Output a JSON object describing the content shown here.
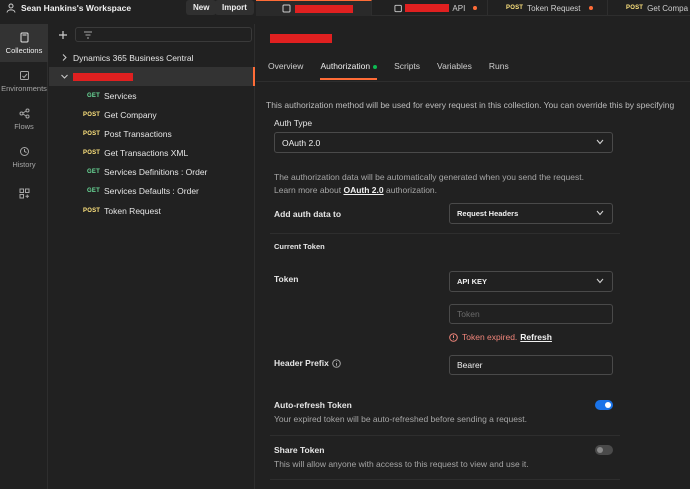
{
  "workspace": {
    "title": "Sean Hankins's Workspace",
    "new_label": "New",
    "import_label": "Import"
  },
  "rail": [
    {
      "label": "Collections",
      "icon": "collections-icon"
    },
    {
      "label": "Environments",
      "icon": "environments-icon"
    },
    {
      "label": "Flows",
      "icon": "flows-icon"
    },
    {
      "label": "History",
      "icon": "history-icon"
    },
    {
      "label": "",
      "icon": "configure-workbench-icon"
    }
  ],
  "sidebar": {
    "collections": [
      {
        "name": "Dynamics 365 Business Central",
        "expanded": false
      },
      {
        "name": "",
        "expanded": true,
        "redacted": true
      }
    ],
    "requests": [
      {
        "method": "GET",
        "name": "Services"
      },
      {
        "method": "POST",
        "name": "Get Company"
      },
      {
        "method": "POST",
        "name": "Post Transactions"
      },
      {
        "method": "POST",
        "name": "Get Transactions XML"
      },
      {
        "method": "GET",
        "name": "Services Definitions : Order"
      },
      {
        "method": "GET",
        "name": "Services Defaults : Order"
      },
      {
        "method": "POST",
        "name": "Token Request"
      }
    ]
  },
  "tabs": [
    {
      "method": "",
      "name": "",
      "redacted": true
    },
    {
      "method": "",
      "name": "API",
      "redacted": true,
      "unsaved": true
    },
    {
      "method": "POST",
      "name": "Token Request",
      "unsaved": true
    },
    {
      "method": "POST",
      "name": "Get Compa"
    }
  ],
  "main": {
    "subtabs": [
      "Overview",
      "Authorization",
      "Scripts",
      "Variables",
      "Runs"
    ],
    "active_subtab": "Authorization",
    "info_text": "This authorization method will be used for every request in this collection. You can override this by specifying",
    "auth_type_label": "Auth Type",
    "auth_type_value": "OAuth 2.0",
    "oauth_note_line1": "The authorization data will be automatically generated when you send the request.",
    "oauth_note_prefix": "Learn more about ",
    "oauth_note_link": "OAuth 2.0",
    "oauth_note_suffix": " authorization.",
    "add_auth_label": "Add auth data to",
    "add_auth_value": "Request Headers",
    "current_token_label": "Current Token",
    "token_label": "Token",
    "token_select": "API KEY",
    "token_placeholder": "Token",
    "token_expired": "Token expired.",
    "refresh_label": "Refresh",
    "header_prefix_label": "Header Prefix",
    "header_prefix_value": "Bearer",
    "auto_refresh_label": "Auto-refresh Token",
    "auto_refresh_desc": "Your expired token will be auto-refreshed before sending a request.",
    "auto_refresh_on": true,
    "share_token_label": "Share Token",
    "share_token_desc": "This will allow anyone with access to this request to view and use it.",
    "share_token_on": false
  },
  "colors": {
    "accent": "#ff6c37",
    "get": "#6bdd9a",
    "post": "#ffe47e",
    "toggle_on": "#1a73e8",
    "error": "#f0857a"
  }
}
